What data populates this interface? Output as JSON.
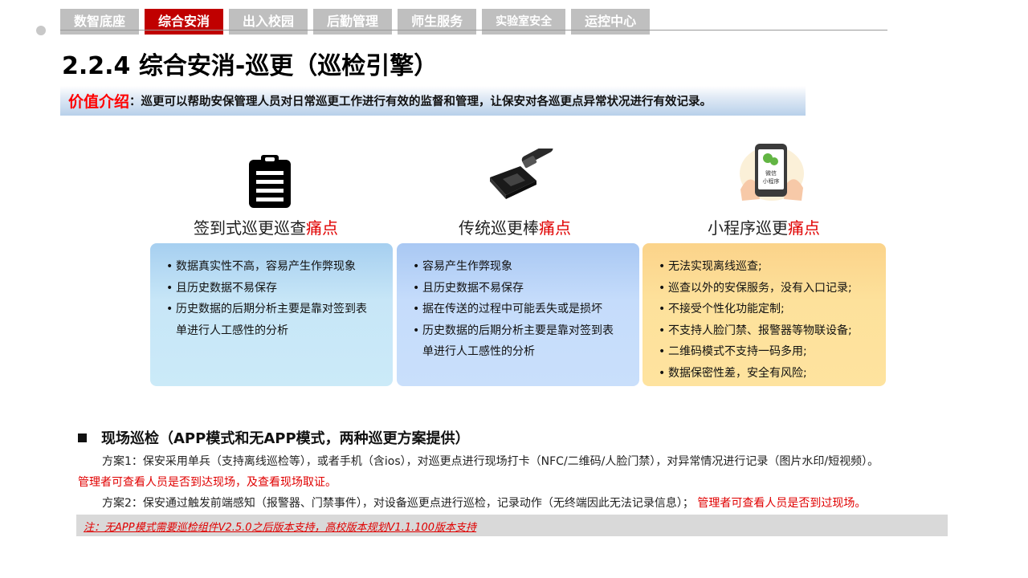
{
  "tabs": [
    {
      "label": "数智底座",
      "active": false
    },
    {
      "label": "综合安消",
      "active": true
    },
    {
      "label": "出入校园",
      "active": false
    },
    {
      "label": "后勤管理",
      "active": false
    },
    {
      "label": "师生服务",
      "active": false
    },
    {
      "label": "实验室安全",
      "active": false
    },
    {
      "label": "运控中心",
      "active": false
    }
  ],
  "page": {
    "title": "2.2.4 综合安消-巡更（巡检引擎）",
    "value_label": "价值介绍",
    "value_text": "：巡更可以帮助安保管理人员对日常巡更工作进行有效的监督和管理，让保安对各巡更点异常状况进行有效记录。"
  },
  "columns": [
    {
      "title": "签到式巡更巡查",
      "pain": "痛点",
      "icon": "clipboard-icon",
      "items": [
        "数据真实性不高，容易产生作弊现象",
        "且历史数据不易保存",
        "历史数据的后期分析主要是靠对签到表",
        "单进行人工感性的分析"
      ]
    },
    {
      "title": "传统巡更棒",
      "pain": "痛点",
      "icon": "patrol-stick-icon",
      "items": [
        "容易产生作弊现象",
        "且历史数据不易保存",
        "据在传送的过程中可能丢失或是损坏",
        "历史数据的后期分析主要是靠对签到表",
        "单进行人工感性的分析"
      ]
    },
    {
      "title": "小程序巡更",
      "pain": "痛点",
      "icon": "wechat-miniprogram-icon",
      "phone_line1": "微信",
      "phone_line2": "小程序",
      "items": [
        "无法实现离线巡查;",
        "巡查以外的安保服务，没有入口记录;",
        "不接受个性化功能定制;",
        "不支持人脸门禁、报警器等物联设备;",
        "二维码模式不支持一码多用;",
        "数据保密性差，安全有风险;"
      ]
    }
  ],
  "section": {
    "heading": "现场巡检（APP模式和无APP模式，两种巡更方案提供）",
    "plan1": "方案1：保安采用单兵（支持离线巡检等），或者手机（含ios），对巡更点进行现场打卡（NFC/二维码/人脸门禁），对异常情况进行记录（图片水印/短视频）。",
    "plan1_red": "管理者可查看人员是否到达现场，及查看现场取证。",
    "plan2": "方案2：保安通过触发前端感知（报警器、门禁事件），对设备巡更点进行巡检，记录动作（无终端因此无法记录信息）；",
    "plan2_red": "管理者可查看人员是否到过现场。",
    "note": "注：无APP模式需要巡检组件V2.5.0之后版本支持，高校版本规划V1.1.100版本支持"
  },
  "colors": {
    "accent_red": "#c00000",
    "pain_red": "#e00000",
    "tab_gray": "#bfbfbf"
  }
}
